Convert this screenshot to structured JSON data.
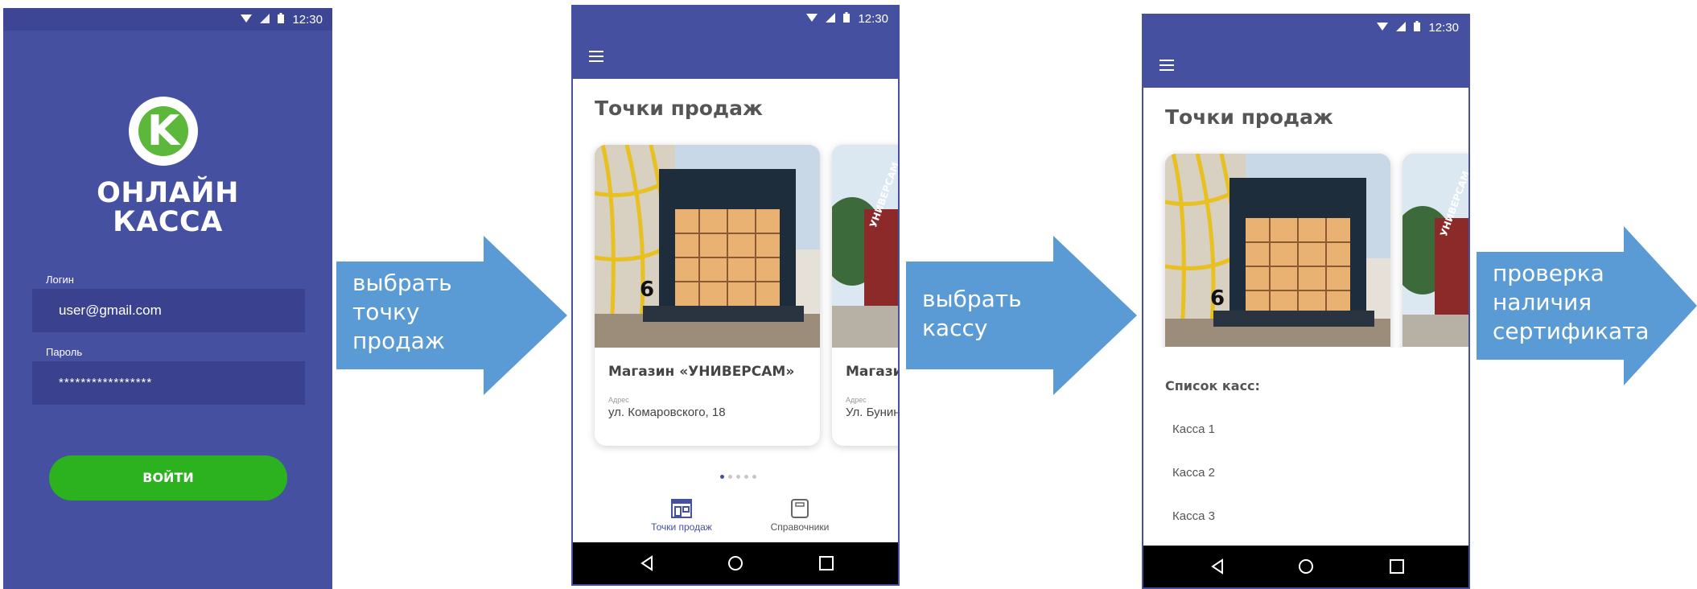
{
  "status": {
    "time": "12:30"
  },
  "login": {
    "logo_letter": "K",
    "logo_line1": "ОНЛАЙН",
    "logo_line2": "КАССА",
    "login_label": "Логин",
    "login_value": "user@gmail.com",
    "password_label": "Пароль",
    "password_value": "*****************",
    "submit_label": "ВОЙТИ"
  },
  "arrows": [
    {
      "lines": [
        "выбрать",
        "точку",
        "продаж"
      ]
    },
    {
      "lines": [
        "выбрать",
        "кассу"
      ]
    },
    {
      "lines": [
        "проверка",
        "наличия",
        "сертификата"
      ]
    }
  ],
  "sales_points": {
    "title": "Точки продаж",
    "cards": [
      {
        "name": "Магазин «УНИВЕРСАМ»",
        "address_label": "Адрес",
        "address": "ул. Комаровского, 18",
        "sign": "6"
      },
      {
        "name": "Магазин",
        "address_label": "Адрес",
        "address": "Ул. Бунина",
        "sign": "УНИВЕРСАМ"
      }
    ],
    "tabs": [
      {
        "label": "Точки продаж",
        "icon": "storefront-icon",
        "active": true
      },
      {
        "label": "Справочники",
        "icon": "book-icon",
        "active": false
      }
    ]
  },
  "registers": {
    "title": "Точки продаж",
    "list_title": "Список касс:",
    "items": [
      "Касса 1",
      "Касса 2",
      "Касса 3"
    ]
  },
  "colors": {
    "brand": "#4650a0",
    "accent_green": "#2bb21e",
    "arrow_blue": "#5b9bd5"
  }
}
